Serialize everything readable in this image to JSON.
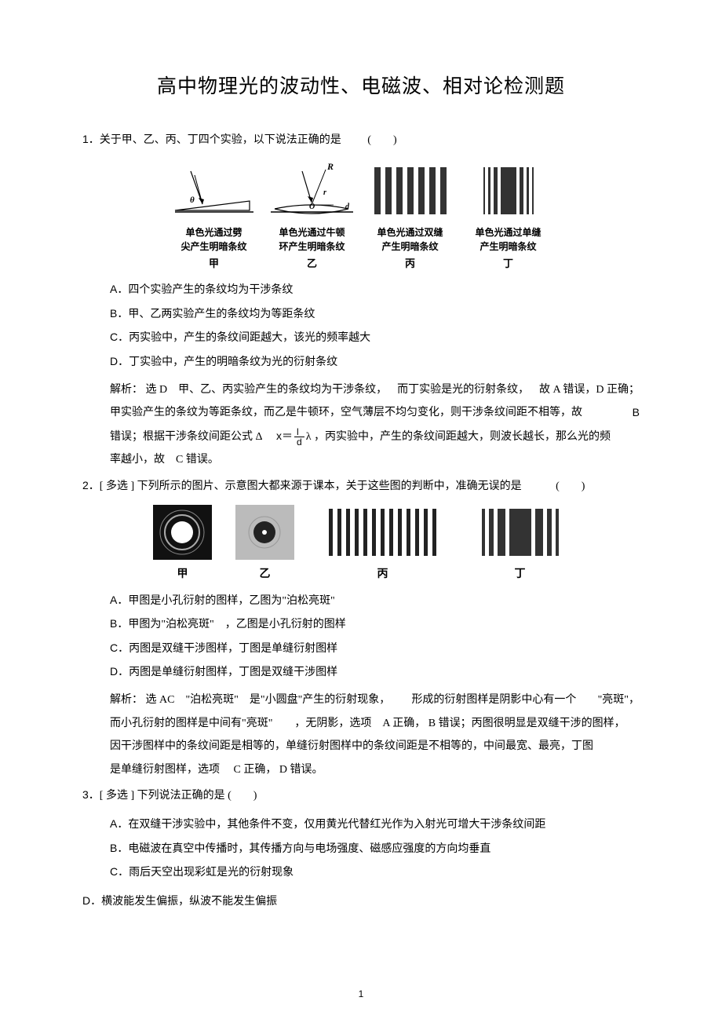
{
  "title": "高中物理光的波动性、电磁波、相对论检测题",
  "q1": {
    "stem_prefix": "1．",
    "stem": "关于甲、乙、丙、丁四个实验，以下说法正确的是",
    "paren": "(　　)",
    "figs": [
      {
        "caption": "单色光通过劈\n尖产生明暗条纹",
        "label": "甲"
      },
      {
        "caption": "单色光通过牛顿\n环产生明暗条纹",
        "label": "乙"
      },
      {
        "caption": "单色光通过双缝\n产生明暗条纹",
        "label": "丙"
      },
      {
        "caption": "单色光通过单缝\n产生明暗条纹",
        "label": "丁"
      }
    ],
    "opts": {
      "A": "四个实验产生的条纹均为干涉条纹",
      "B": "甲、乙两实验产生的条纹均为等距条纹",
      "C": "丙实验中，产生的条纹间距越大，该光的频率越大",
      "D": "丁实验中，产生的明暗条纹为光的衍射条纹"
    },
    "explain_p1_a": "解析：  选 D　甲、乙、丙实验产生的条纹均为干涉条纹，",
    "explain_p1_b": "而丁实验是光的衍射条纹，",
    "explain_p1_c": "故 A 错误，D 正确；",
    "explain_p2": "甲实验产生的条纹为等距条纹，而乙是牛顿环，空气薄层不均匀变化，则干涉条纹间距不相等，故",
    "explain_p2_tail": "B",
    "explain_p3_a": "错误；根据干涉条纹间距公式 Δ",
    "explain_p3_b": "x＝",
    "explain_p3_c": "λ ，丙实验中，产生的条纹间距越大，则波长越长，那么光的频",
    "explain_p4": "率越小，故　C 错误。"
  },
  "q2": {
    "stem_prefix": "2．",
    "tag": "[ 多选 ]",
    "stem": " 下列所示的图片、示意图大都来源于课本，关于这些图的判断中，准确无误的是",
    "paren": "(　　)",
    "figs": [
      {
        "label": "甲"
      },
      {
        "label": "乙"
      },
      {
        "label": "丙"
      },
      {
        "label": "丁"
      }
    ],
    "opts": {
      "A": "甲图是小孔衍射的图样，乙图为\"泊松亮斑\"",
      "B": "甲图为\"泊松亮斑\"　，乙图是小孔衍射的图样",
      "C": "丙图是双缝干涉图样，丁图是单缝衍射图样",
      "D": "丙图是单缝衍射图样，丁图是双缝干涉图样"
    },
    "explain_1a": "解析：  选 AC　\"泊松亮斑\"　是\"小圆盘\"产生的衍射现象，",
    "explain_1b": "形成的衍射图样是阴影中心有一个",
    "explain_1c": "\"亮斑\"，",
    "explain_2": "而小孔衍射的图样是中间有\"亮斑\"　　，无阴影，选项　A 正确，  B 错误；丙图很明显是双缝干涉的图样，",
    "explain_3": "因干涉图样中的条纹间距是相等的，单缝衍射图样中的条纹间距是不相等的，中间最宽、最亮，丁图",
    "explain_4": "是单缝衍射图样，选项　 C 正确，  D 错误。"
  },
  "q3": {
    "stem_prefix": "3．",
    "tag": "[ 多选 ]",
    "stem": " 下列说法正确的是   (　　)",
    "opts": {
      "A": "在双缝干涉实验中，其他条件不变，仅用黄光代替红光作为入射光可增大干涉条纹间距",
      "B": "电磁波在真空中传播时，其传播方向与电场强度、磁感应强度的方向均垂直",
      "C": "雨后天空出现彩虹是光的衍射现象",
      "D": "横波能发生偏振，纵波不能发生偏振"
    }
  },
  "page_num": "1"
}
